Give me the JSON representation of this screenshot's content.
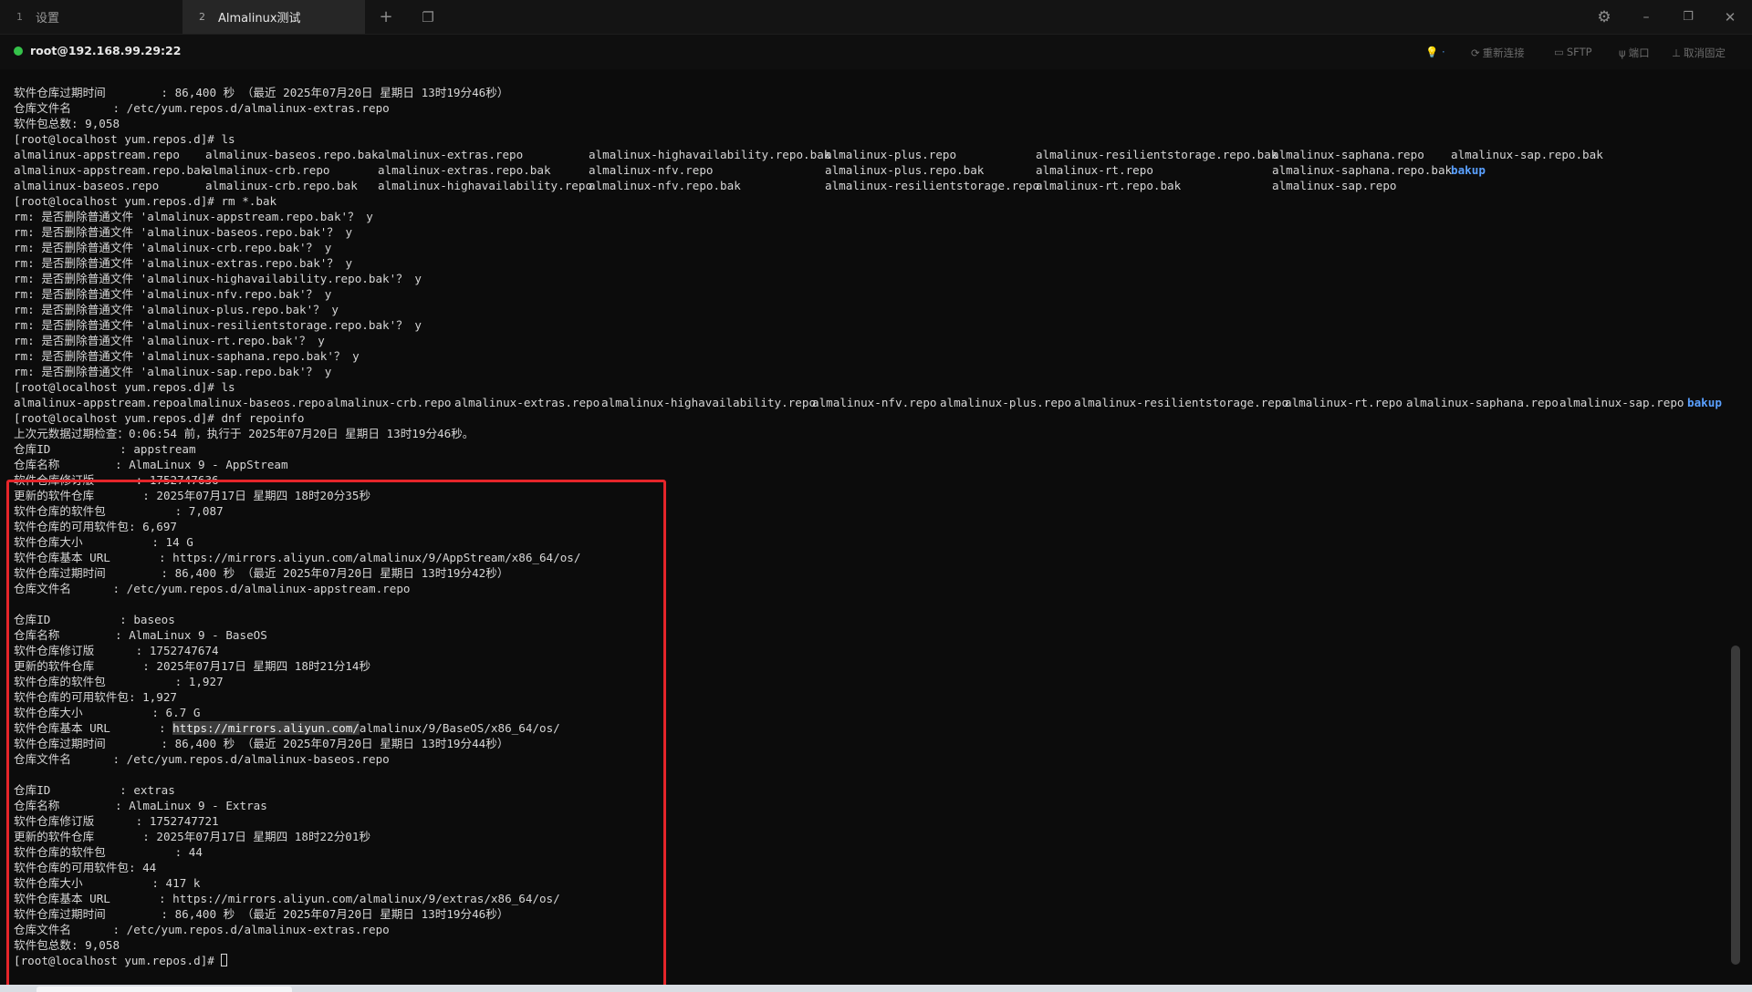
{
  "tabs": [
    {
      "num": "1",
      "label": "设置"
    },
    {
      "num": "2",
      "label": "Almalinux测试"
    }
  ],
  "tabbar_icons": {
    "new_tab": "+",
    "tab_list": "❐",
    "settings": "⚙",
    "minimize": "–",
    "restore": "❐",
    "close": "✕"
  },
  "session": {
    "host": "root@192.168.99.29:22",
    "status_color": "#35c24a",
    "actions": {
      "lamp": "💡 ·",
      "reconnect": "重新连接",
      "sftp": "SFTP",
      "port": "端口",
      "unpin": "取消固定"
    }
  },
  "terminal": {
    "head": [
      "软件仓库过期时间        : 86,400 秒 （最近 2025年07月20日 星期日 13时19分46秒）",
      "仓库文件名      : /etc/yum.repos.d/almalinux-extras.repo",
      "软件包总数: 9,058",
      "[root@localhost yum.repos.d]# ls"
    ],
    "ls1": [
      [
        "almalinux-appstream.repo",
        "almalinux-baseos.repo.bak",
        "almalinux-extras.repo",
        "almalinux-highavailability.repo.bak",
        "almalinux-plus.repo",
        "almalinux-resilientstorage.repo.bak",
        "almalinux-saphana.repo",
        "almalinux-sap.repo.bak"
      ],
      [
        "almalinux-appstream.repo.bak",
        "almalinux-crb.repo",
        "almalinux-extras.repo.bak",
        "almalinux-nfv.repo",
        "almalinux-plus.repo.bak",
        "almalinux-rt.repo",
        "almalinux-saphana.repo.bak",
        "bakup"
      ],
      [
        "almalinux-baseos.repo",
        "almalinux-crb.repo.bak",
        "almalinux-highavailability.repo",
        "almalinux-nfv.repo.bak",
        "almalinux-resilientstorage.repo",
        "almalinux-rt.repo.bak",
        "almalinux-sap.repo",
        ""
      ]
    ],
    "rm_block": [
      "[root@localhost yum.repos.d]# rm *.bak",
      "rm: 是否删除普通文件 'almalinux-appstream.repo.bak'？ y",
      "rm: 是否删除普通文件 'almalinux-baseos.repo.bak'？ y",
      "rm: 是否删除普通文件 'almalinux-crb.repo.bak'？ y",
      "rm: 是否删除普通文件 'almalinux-extras.repo.bak'？ y",
      "rm: 是否删除普通文件 'almalinux-highavailability.repo.bak'？ y",
      "rm: 是否删除普通文件 'almalinux-nfv.repo.bak'？ y",
      "rm: 是否删除普通文件 'almalinux-plus.repo.bak'？ y",
      "rm: 是否删除普通文件 'almalinux-resilientstorage.repo.bak'？ y",
      "rm: 是否删除普通文件 'almalinux-rt.repo.bak'？ y",
      "rm: 是否删除普通文件 'almalinux-saphana.repo.bak'？ y",
      "rm: 是否删除普通文件 'almalinux-sap.repo.bak'？ y",
      "[root@localhost yum.repos.d]# ls"
    ],
    "ls2": [
      "almalinux-appstream.repo",
      "almalinux-baseos.repo",
      "almalinux-crb.repo",
      "almalinux-extras.repo",
      "almalinux-highavailability.repo",
      "almalinux-nfv.repo",
      "almalinux-plus.repo",
      "almalinux-resilientstorage.repo",
      "almalinux-rt.repo",
      "almalinux-saphana.repo",
      "almalinux-sap.repo",
      "bakup"
    ],
    "repoinfo_block": [
      "[root@localhost yum.repos.d]# dnf repoinfo",
      "上次元数据过期检查：0:06:54 前，执行于 2025年07月20日 星期日 13时19分46秒。",
      "仓库ID          : appstream",
      "仓库名称        : AlmaLinux 9 - AppStream",
      "软件仓库修订版      : 1752747636",
      "更新的软件仓库       : 2025年07月17日 星期四 18时20分35秒",
      "软件仓库的软件包          : 7,087",
      "软件仓库的可用软件包: 6,697",
      "软件仓库大小          : 14 G",
      "软件仓库基本 URL       : https://mirrors.aliyun.com/almalinux/9/AppStream/x86_64/os/",
      "软件仓库过期时间        : 86,400 秒 （最近 2025年07月20日 星期日 13时19分42秒）",
      "仓库文件名      : /etc/yum.repos.d/almalinux-appstream.repo",
      "",
      "仓库ID          : baseos",
      "仓库名称        : AlmaLinux 9 - BaseOS",
      "软件仓库修订版      : 1752747674",
      "更新的软件仓库       : 2025年07月17日 星期四 18时21分14秒",
      "软件仓库的软件包          : 1,927",
      "软件仓库的可用软件包: 1,927",
      "软件仓库大小          : 6.7 G"
    ],
    "url_line": {
      "prefix": "软件仓库基本 URL       : ",
      "selected": "https://mirrors.aliyun.com/",
      "rest": "almalinux/9/BaseOS/x86_64/os/"
    },
    "tail_block": [
      "软件仓库过期时间        : 86,400 秒 （最近 2025年07月20日 星期日 13时19分44秒）",
      "仓库文件名      : /etc/yum.repos.d/almalinux-baseos.repo",
      "",
      "仓库ID          : extras",
      "仓库名称        : AlmaLinux 9 - Extras",
      "软件仓库修订版      : 1752747721",
      "更新的软件仓库       : 2025年07月17日 星期四 18时22分01秒",
      "软件仓库的软件包          : 44",
      "软件仓库的可用软件包: 44",
      "软件仓库大小          : 417 k",
      "软件仓库基本 URL       : https://mirrors.aliyun.com/almalinux/9/extras/x86_64/os/",
      "软件仓库过期时间        : 86,400 秒 （最近 2025年07月20日 星期日 13时19分46秒）",
      "仓库文件名      : /etc/yum.repos.d/almalinux-extras.repo",
      "软件包总数: 9,058"
    ],
    "prompt": "[root@localhost yum.repos.d]# ",
    "colors": {
      "highlight_box": "#e5252a",
      "directory": "#5aa0ff",
      "text": "#d6d6d6",
      "background": "#0c0c0c"
    }
  }
}
